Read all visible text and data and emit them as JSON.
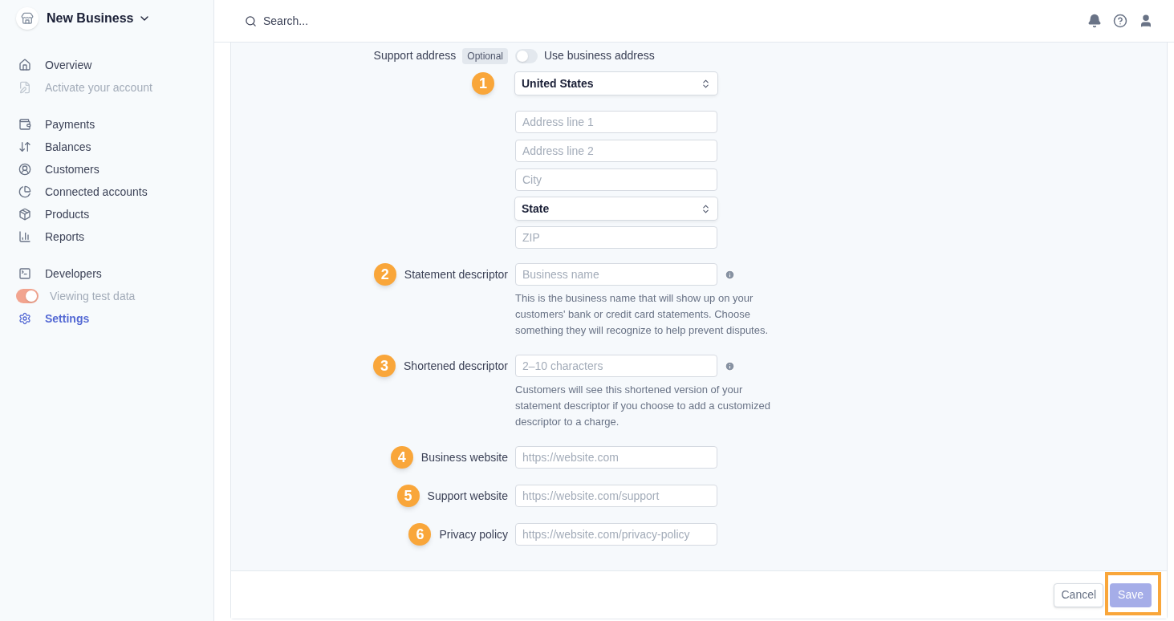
{
  "sidebar": {
    "business": "New Business",
    "groups": [
      [
        {
          "kind": "link",
          "label": "Overview",
          "selected": false,
          "disabled": false
        },
        {
          "kind": "link",
          "label": "Activate your account",
          "selected": false,
          "disabled": true
        }
      ],
      [
        {
          "kind": "link",
          "label": "Payments",
          "selected": false,
          "disabled": false
        },
        {
          "kind": "link",
          "label": "Balances",
          "selected": false,
          "disabled": false
        },
        {
          "kind": "link",
          "label": "Customers",
          "selected": false,
          "disabled": false
        },
        {
          "kind": "link",
          "label": "Connected accounts",
          "selected": false,
          "disabled": false
        },
        {
          "kind": "link",
          "label": "Products",
          "selected": false,
          "disabled": false
        },
        {
          "kind": "link",
          "label": "Reports",
          "selected": false,
          "disabled": false
        }
      ],
      [
        {
          "kind": "link",
          "label": "Developers",
          "selected": false,
          "disabled": false
        },
        {
          "kind": "toggle",
          "label": "Viewing test data",
          "on": true,
          "disabled": true
        },
        {
          "kind": "link",
          "label": "Settings",
          "selected": true,
          "disabled": false
        }
      ]
    ]
  },
  "header": {
    "search_placeholder": "Search..."
  },
  "support_address": {
    "label": "Support address",
    "badge": "Optional",
    "toggle": {
      "label": "Use business address",
      "on": false
    },
    "fields": [
      {
        "kind": "select",
        "value": "United States",
        "marker": "1"
      },
      {
        "kind": "input",
        "placeholder": "Address line 1"
      },
      {
        "kind": "input",
        "placeholder": "Address line 2"
      },
      {
        "kind": "input",
        "placeholder": "City"
      },
      {
        "kind": "select",
        "value": "State"
      },
      {
        "kind": "input",
        "placeholder": "ZIP"
      }
    ]
  },
  "rows": [
    {
      "marker": "2",
      "label": "Statement descriptor",
      "placeholder": "Business name",
      "info": true,
      "help": "This is the business name that will show up on your customers' bank or credit card statements. Choose something they will recognize to help prevent disputes."
    },
    {
      "marker": "3",
      "label": "Shortened descriptor",
      "placeholder": "2–10 characters",
      "info": true,
      "help": "Customers will see this shortened version of your statement descriptor if you choose to add a customized descriptor to a charge."
    },
    {
      "marker": "4",
      "label": "Business website",
      "placeholder": "https://website.com",
      "info": false
    },
    {
      "marker": "5",
      "label": "Support website",
      "placeholder": "https://website.com/support",
      "info": false
    },
    {
      "marker": "6",
      "label": "Privacy policy",
      "placeholder": "https://website.com/privacy-policy",
      "info": false
    }
  ],
  "footer": {
    "cancel": "Cancel",
    "save": {
      "label": "Save",
      "disabled": true,
      "highlighted": true
    }
  }
}
